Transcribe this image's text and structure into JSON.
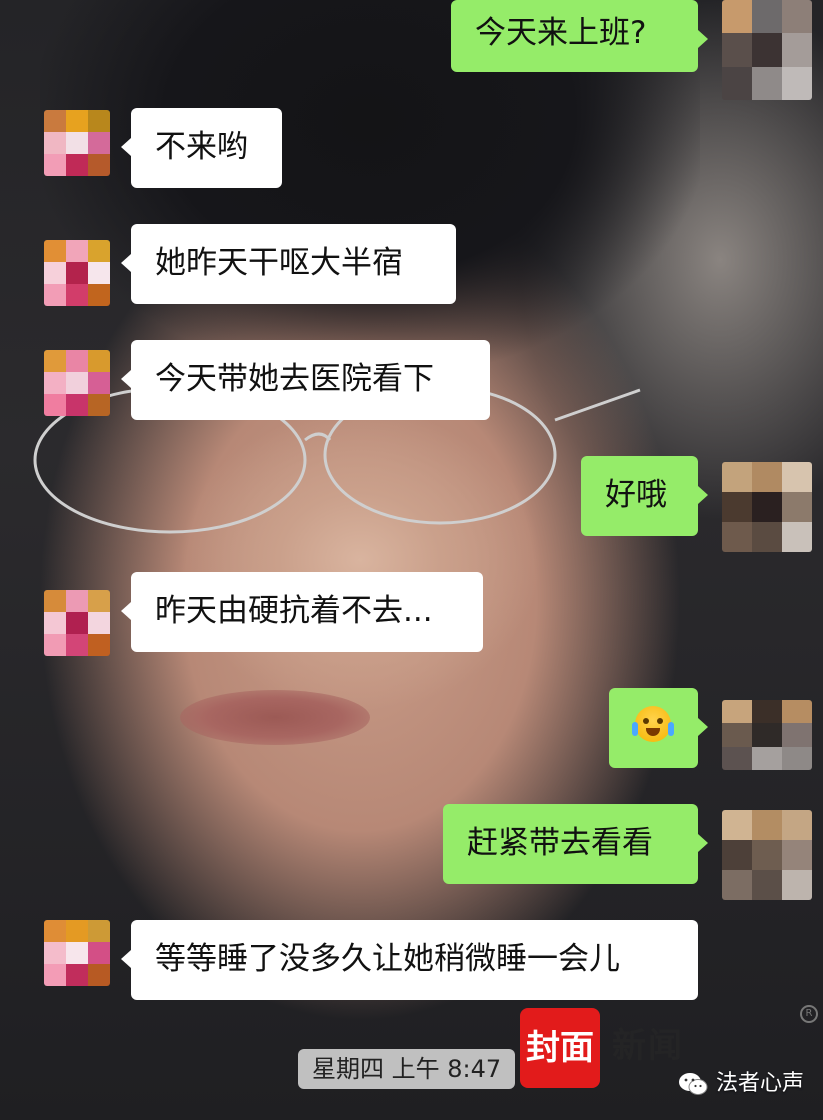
{
  "messages": [
    {
      "side": "right",
      "text": "今天来上班?"
    },
    {
      "side": "left",
      "text": "不来哟"
    },
    {
      "side": "left",
      "text": "她昨天干呕大半宿"
    },
    {
      "side": "left",
      "text": "今天带她去医院看下"
    },
    {
      "side": "right",
      "text": "好哦"
    },
    {
      "side": "left",
      "text": "昨天由硬抗着不去..."
    },
    {
      "side": "right",
      "emoji": "crying-laughing-emoji"
    },
    {
      "side": "right",
      "text": "赶紧带去看看"
    },
    {
      "side": "left",
      "text": "等等睡了没多久让她稍微睡一会儿"
    }
  ],
  "timestamp": "星期四 上午 8:47",
  "logo": {
    "badge": "封面",
    "text": "新闻"
  },
  "watermark": "法者心声",
  "colors": {
    "bubble_right": "#95ec69",
    "bubble_left": "#ffffff",
    "logo_red": "#e21b1b"
  }
}
